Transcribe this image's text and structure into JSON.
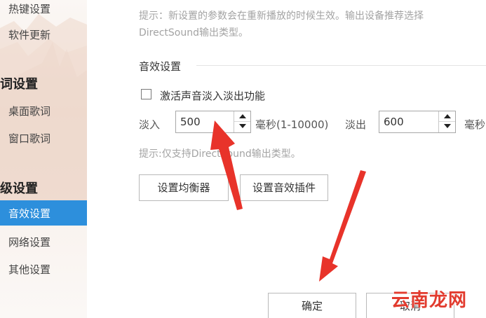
{
  "sidebar": {
    "items": [
      {
        "label": "热键设置"
      },
      {
        "label": "软件更新"
      },
      {
        "label": "词设置"
      },
      {
        "label": "桌面歌词"
      },
      {
        "label": "窗口歌词"
      },
      {
        "label": "级设置"
      },
      {
        "label": "音效设置"
      },
      {
        "label": "网络设置"
      },
      {
        "label": "其他设置"
      }
    ],
    "active_color": "#2d8fdc"
  },
  "main": {
    "top_hint_line1": "提示：新设置的参数会在重新播放的时候生效。输出设备推荐选择",
    "top_hint_line2": "DirectSound输出类型。",
    "section_title": "音效设置",
    "fade_checkbox": {
      "label": "激活声音淡入淡出功能",
      "checked": false
    },
    "fade_in": {
      "label": "淡入",
      "value": "500",
      "unit_range": "毫秒(1-10000)"
    },
    "fade_out": {
      "label": "淡出",
      "value": "600",
      "unit": "毫秒"
    },
    "fade_hint": "提示:仅支持DirectSound输出类型。",
    "equalizer_button": "设置均衡器",
    "plugin_button": "设置音效插件",
    "ok_button": "确定",
    "cancel_button": "取消"
  },
  "overlay": {
    "arrow_color": "#e8332a",
    "watermark": "云南龙网"
  }
}
